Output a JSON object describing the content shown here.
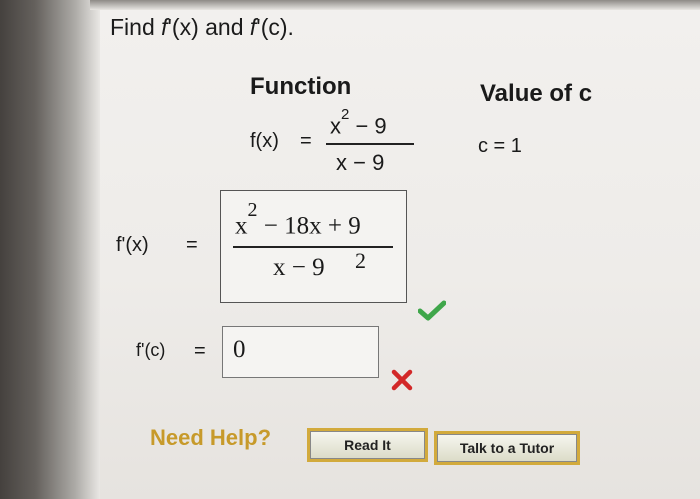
{
  "question": {
    "prefix": "Find ",
    "f1": "f",
    "mid1": "'(x) and ",
    "f2": "f",
    "mid2": "'(c)."
  },
  "table": {
    "function_header": "Function",
    "value_header": "Value of c",
    "fx_label": "f(x)",
    "equals": "=",
    "fx_numerator_base": "x",
    "fx_numerator_exp": "2",
    "fx_numerator_rest": " − 9",
    "fx_denominator": "x − 9",
    "c_value": "c = 1"
  },
  "derivative": {
    "label": "f'(x)",
    "equals": "=",
    "numerator_base": "x",
    "numerator_exp": "2",
    "numerator_rest": " − 18x + 9",
    "denominator": "x − 9",
    "denominator_exp": "2",
    "status": "correct"
  },
  "derivative_at_c": {
    "label": "f'(c)",
    "equals": "=",
    "value": "0",
    "status": "incorrect"
  },
  "help": {
    "need_help": "Need Help?",
    "read_it": "Read It",
    "talk_to_tutor": "Talk to a Tutor"
  },
  "colors": {
    "check": "#3fa64a",
    "cross": "#d22828",
    "need_help": "#c79a2a",
    "button_outline": "#d2aa3c"
  }
}
